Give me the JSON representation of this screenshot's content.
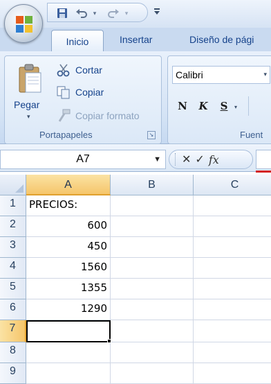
{
  "titlebar": {
    "office_button_icon": "office-logo-icon",
    "quick_access": {
      "save_icon": "save-icon",
      "undo_icon": "undo-icon",
      "redo_icon": "redo-icon",
      "customize_icon": "qat-customize-icon"
    }
  },
  "tabs": [
    {
      "label": "Inicio",
      "active": true
    },
    {
      "label": "Insertar",
      "active": false
    },
    {
      "label": "Diseño de pági",
      "active": false
    }
  ],
  "ribbon": {
    "clipboard": {
      "paste_label": "Pegar",
      "cut_label": "Cortar",
      "copy_label": "Copiar",
      "format_painter_label": "Copiar formato",
      "group_label": "Portapapeles"
    },
    "font": {
      "font_name": "Calibri",
      "bold_label": "N",
      "italic_label": "K",
      "underline_label": "S",
      "group_label": "Fuent"
    }
  },
  "formula_bar": {
    "name_box": "A7",
    "cancel_icon": "✕",
    "enter_icon": "✓",
    "function_label": "fx",
    "formula_value": ""
  },
  "sheet": {
    "columns": [
      "A",
      "B",
      "C"
    ],
    "active_column": "A",
    "active_row": 7,
    "rows": [
      {
        "num": "1",
        "A": "PRECIOS:",
        "B": "",
        "C": ""
      },
      {
        "num": "2",
        "A": "600",
        "B": "",
        "C": ""
      },
      {
        "num": "3",
        "A": "450",
        "B": "",
        "C": ""
      },
      {
        "num": "4",
        "A": "1560",
        "B": "",
        "C": ""
      },
      {
        "num": "5",
        "A": "1355",
        "B": "",
        "C": ""
      },
      {
        "num": "6",
        "A": "1290",
        "B": "",
        "C": ""
      },
      {
        "num": "7",
        "A": "",
        "B": "",
        "C": ""
      },
      {
        "num": "8",
        "A": "",
        "B": "",
        "C": ""
      },
      {
        "num": "9",
        "A": "",
        "B": "",
        "C": ""
      }
    ]
  },
  "colors": {
    "accent": "#15428b",
    "selected_header": "#f5c56a",
    "grid_line": "#d0d7e5"
  }
}
